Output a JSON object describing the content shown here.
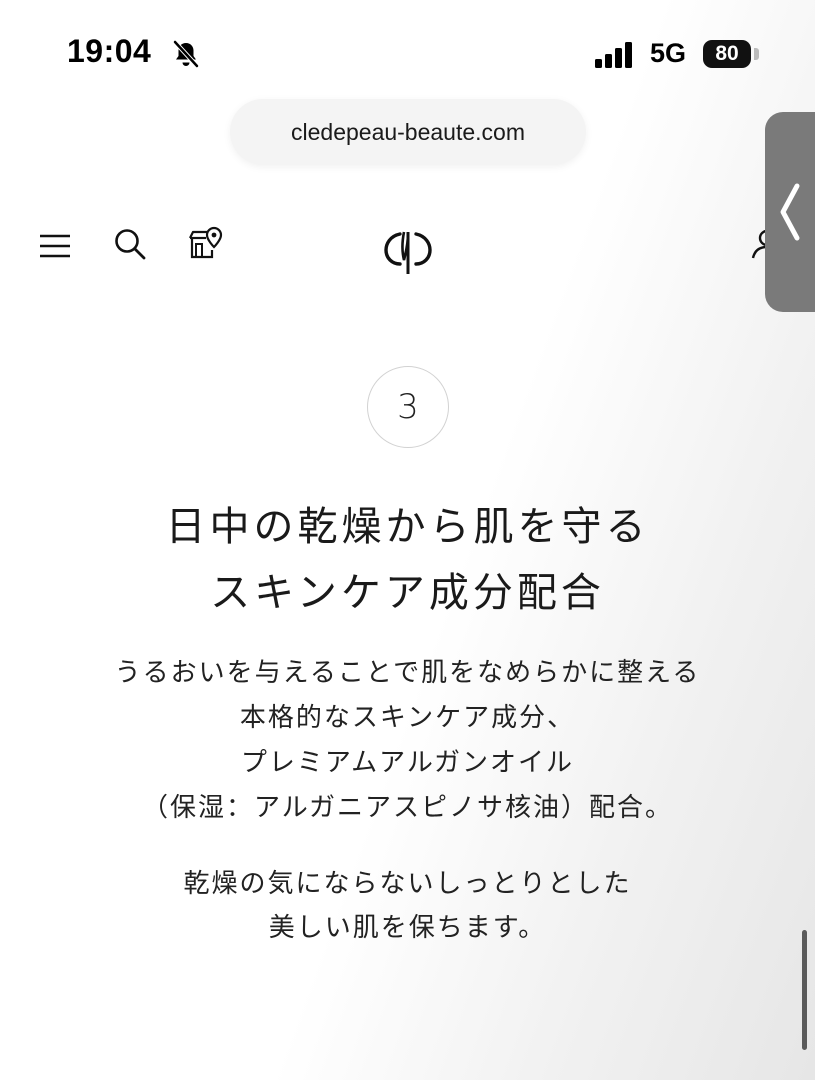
{
  "status_bar": {
    "time": "19:04",
    "network": "5G",
    "battery": "80"
  },
  "browser": {
    "url": "cledepeau-beaute.com"
  },
  "content": {
    "step_number": "3",
    "heading_line1": "日中の乾燥から肌を守る",
    "heading_line2": "スキンケア成分配合",
    "paragraph1": [
      "うるおいを与えることで肌をなめらかに整える",
      "本格的なスキンケア成分、",
      "プレミアムアルガンオイル",
      "（保湿：アルガニアスピノサ核油）配合。"
    ],
    "paragraph2": [
      "乾燥の気にならないしっとりとした",
      "美しい肌を保ちます。"
    ]
  },
  "icons": {
    "mute": "bell-slash-icon",
    "signal": "cellular-signal-icon",
    "menu": "hamburger-menu-icon",
    "search": "search-icon",
    "store": "store-locator-icon",
    "logo": "cle-de-peau-logo-icon",
    "account": "account-icon",
    "back": "chevron-left-icon"
  },
  "colors": {
    "text": "#1a1a1a",
    "badge_border": "#d2d2d2",
    "back_tab": "#7a7a7a"
  }
}
